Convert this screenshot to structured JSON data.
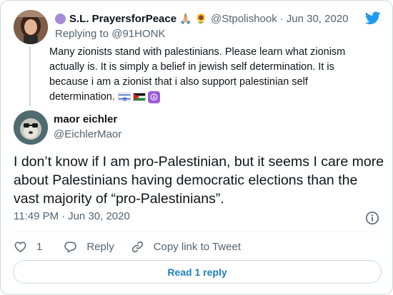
{
  "parent": {
    "name": "S.L. PrayersforPeace",
    "name_emojis": [
      "🙏🏼",
      "🌻"
    ],
    "handle": "@Stpolishook",
    "separator": "·",
    "date": "Jun 30, 2020",
    "replying_label": "Replying to",
    "replying_handle": "@91HONK",
    "text": "Many zionists stand with palestinians. Please learn what zionism actually is. It is simply a belief in jewish self determination. It is because i am a zionist that i also support palestinian self determination.",
    "trailing_emojis": [
      "israel-flag",
      "palestine-flag",
      "peace-symbol"
    ]
  },
  "tweet": {
    "name": "maor eichler",
    "handle": "@EichlerMaor",
    "text": "I don’t know if I am pro-Palestinian, but it seems I care more about Palestinians having democratic elections than the vast majority of “pro-Palestinians”.",
    "time": "11:49 PM",
    "separator": "·",
    "date": "Jun 30, 2020"
  },
  "actions": {
    "like_count": "1",
    "reply_label": "Reply",
    "copy_label": "Copy link to Tweet"
  },
  "read_replies_label": "Read 1 reply",
  "colors": {
    "accent": "#1d9bf0",
    "read_text": "#1d7fc4",
    "muted": "#536471",
    "border": "#cfd9de"
  }
}
